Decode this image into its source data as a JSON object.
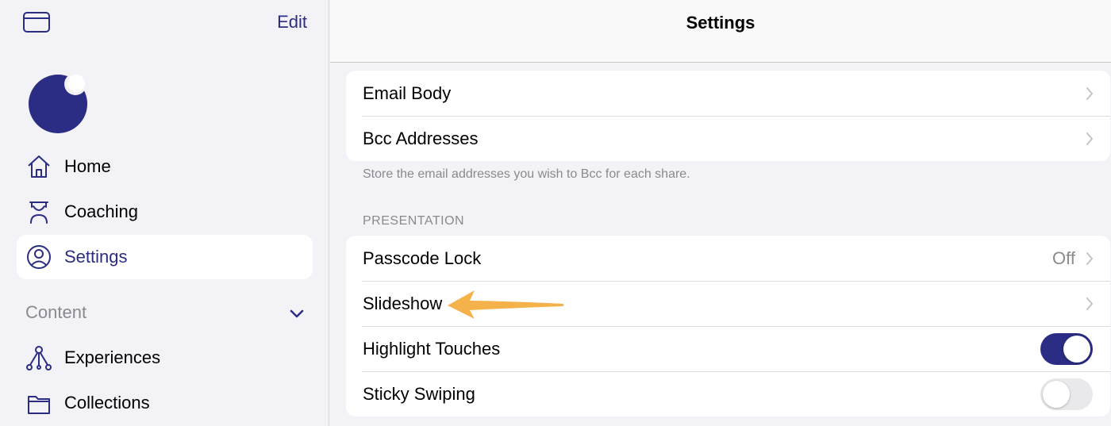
{
  "sidebar": {
    "edit_label": "Edit",
    "items": [
      {
        "label": "Home",
        "icon": "home-icon"
      },
      {
        "label": "Coaching",
        "icon": "coaching-icon"
      },
      {
        "label": "Settings",
        "icon": "person-circle-icon"
      },
      {
        "label": "Experiences",
        "icon": "experiences-icon"
      },
      {
        "label": "Collections",
        "icon": "folder-icon"
      }
    ],
    "content_section_label": "Content",
    "selected": "Settings"
  },
  "header": {
    "title": "Settings"
  },
  "email_group": {
    "rows": [
      {
        "label": "Email Body"
      },
      {
        "label": "Bcc Addresses"
      }
    ],
    "footer": "Store the email addresses you wish to Bcc for each share."
  },
  "presentation_group": {
    "header": "PRESENTATION",
    "rows": [
      {
        "label": "Passcode Lock",
        "value": "Off"
      },
      {
        "label": "Slideshow"
      },
      {
        "label": "Highlight Touches",
        "toggle": true
      },
      {
        "label": "Sticky Swiping",
        "toggle": false
      }
    ]
  },
  "colors": {
    "accent": "#2b2c84",
    "annotation_arrow": "#f5b14a",
    "background": "#f2f2f7"
  }
}
